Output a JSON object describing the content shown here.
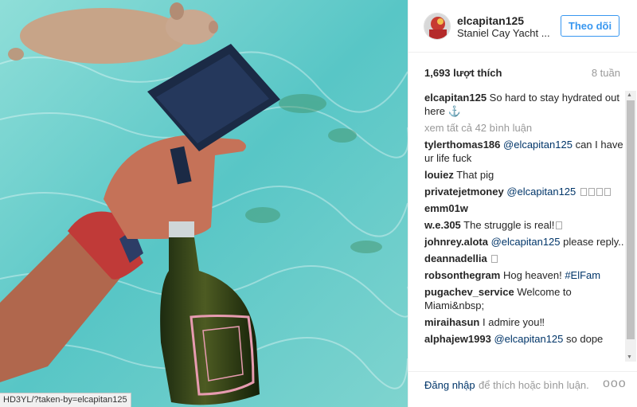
{
  "status_url": "HD3YL/?taken-by=elcapitan125",
  "header": {
    "username": "elcapitan125",
    "location": "Staniel Cay Yacht ...",
    "follow_label": "Theo dõi"
  },
  "stats": {
    "likes": "1,693 lượt thích",
    "time": "8 tuần"
  },
  "caption": {
    "user": "elcapitan125",
    "text": "So hard to stay hydrated out here ⚓"
  },
  "view_all": "xem tất cả 42 bình luận",
  "comments": [
    {
      "user": "tylerthomas186",
      "mention": "@elcapitan125",
      "text": "can I have ur life fuck"
    },
    {
      "user": "louiez",
      "text": "That pig"
    },
    {
      "user": "privatejetmoney",
      "mention": "@elcapitan125",
      "text": "",
      "boxes": 4
    },
    {
      "user": "emm01w",
      "text": ""
    },
    {
      "user": "w.e.305",
      "text": "The struggle is real!",
      "boxes": 1
    },
    {
      "user": "johnrey.alota",
      "mention": "@elcapitan125",
      "text": "please reply.."
    },
    {
      "user": "deannadellia",
      "text": "",
      "boxes": 1
    },
    {
      "user": "robsonthegram",
      "text": "Hog heaven!",
      "hashtag": "#ElFam"
    },
    {
      "user": "pugachev_service",
      "text": "Welcome to Miami&nbsp;"
    },
    {
      "user": "miraihasun",
      "text": "I admire you‼"
    },
    {
      "user": "alphajew1993",
      "mention": "@elcapitan125",
      "text": "so dope"
    }
  ],
  "footer": {
    "login": "Đăng nhập",
    "rest": "để thích hoặc bình luận.",
    "more": "ooo"
  },
  "colors": {
    "link": "#003569",
    "accent": "#3897f0",
    "muted": "#999999"
  }
}
